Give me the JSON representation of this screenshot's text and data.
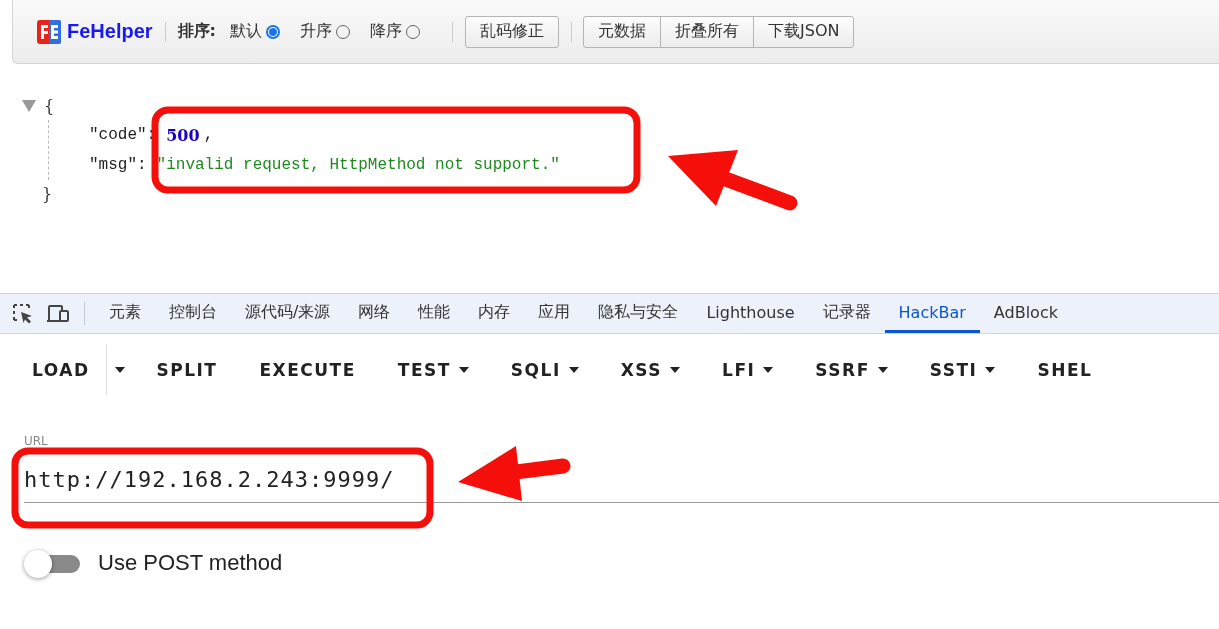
{
  "toolbar": {
    "logo": "FeHelper",
    "sort_label": "排序:",
    "sort_options": [
      {
        "label": "默认",
        "selected": true
      },
      {
        "label": "升序",
        "selected": false
      },
      {
        "label": "降序",
        "selected": false
      }
    ],
    "fix_button": "乱码修正",
    "actions": [
      "元数据",
      "折叠所有",
      "下载JSON"
    ]
  },
  "json_view": {
    "expanded": true,
    "open": "{",
    "close": "}",
    "entries": [
      {
        "key": "\"code\":",
        "value": "500",
        "kind": "number",
        "comma": ","
      },
      {
        "key": "\"msg\":",
        "value": "\"invalid request, HttpMethod not support.\"",
        "kind": "string"
      }
    ]
  },
  "devtools_tabs": [
    {
      "label": "元素",
      "selected": false
    },
    {
      "label": "控制台",
      "selected": false
    },
    {
      "label": "源代码/来源",
      "selected": false
    },
    {
      "label": "网络",
      "selected": false
    },
    {
      "label": "性能",
      "selected": false
    },
    {
      "label": "内存",
      "selected": false
    },
    {
      "label": "应用",
      "selected": false
    },
    {
      "label": "隐私与安全",
      "selected": false
    },
    {
      "label": "Lighthouse",
      "selected": false
    },
    {
      "label": "记录器",
      "selected": false
    },
    {
      "label": "HackBar",
      "selected": true
    },
    {
      "label": "AdBlock",
      "selected": false
    }
  ],
  "hackbar_buttons": [
    {
      "label": "LOAD",
      "kind": "split"
    },
    {
      "label": "SPLIT",
      "kind": "plain"
    },
    {
      "label": "EXECUTE",
      "kind": "plain"
    },
    {
      "label": "TEST",
      "kind": "menu"
    },
    {
      "label": "SQLI",
      "kind": "menu"
    },
    {
      "label": "XSS",
      "kind": "menu"
    },
    {
      "label": "LFI",
      "kind": "menu"
    },
    {
      "label": "SSRF",
      "kind": "menu"
    },
    {
      "label": "SSTI",
      "kind": "menu"
    },
    {
      "label": "SHEL",
      "kind": "plain"
    }
  ],
  "url_field": {
    "label": "URL",
    "value": "http://192.168.2.243:9999/"
  },
  "post_toggle": {
    "on": false,
    "label": "Use POST method"
  }
}
